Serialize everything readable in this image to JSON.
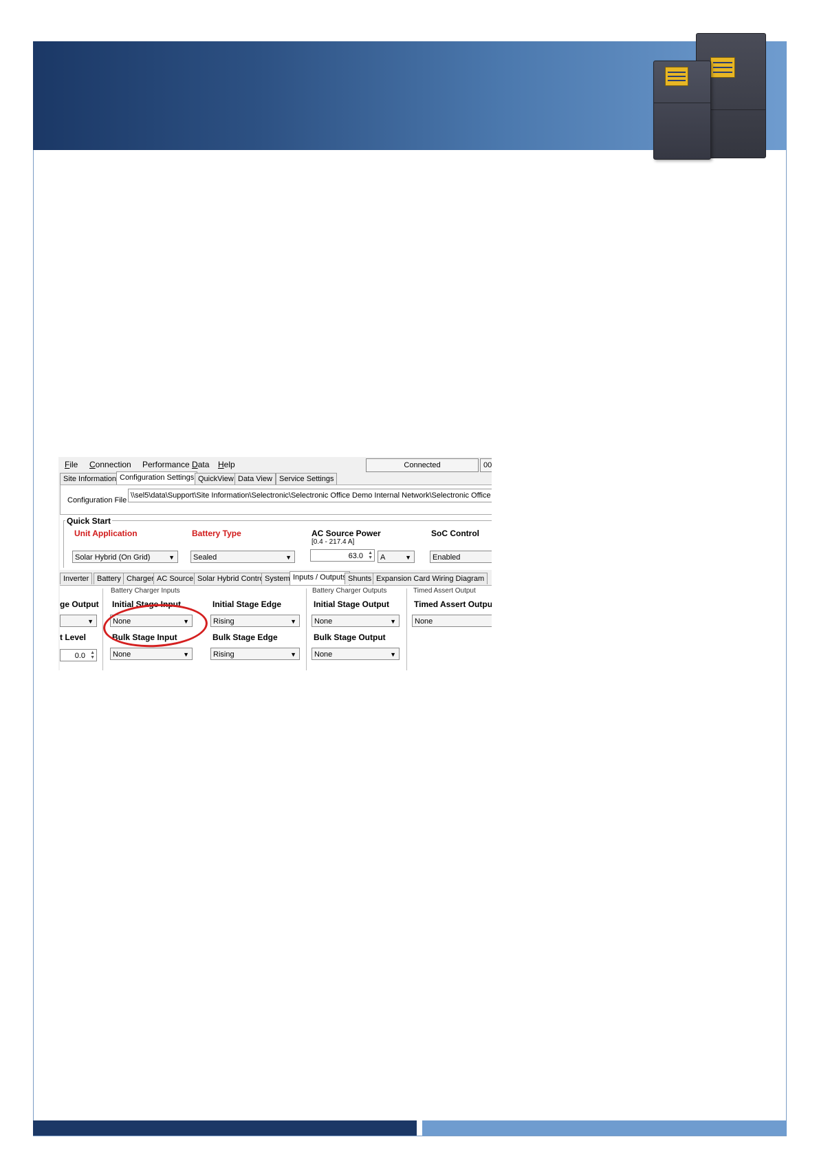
{
  "app": {
    "menu": [
      {
        "label": "File",
        "key": "F"
      },
      {
        "label": "Connection",
        "key": "C"
      },
      {
        "label": "Performance Data",
        "key": "D"
      },
      {
        "label": "Help",
        "key": "H"
      }
    ],
    "status": "Connected",
    "status2": "00",
    "main_tabs": [
      {
        "label": "Site Information",
        "active": false
      },
      {
        "label": "Configuration Settings",
        "active": true
      },
      {
        "label": "QuickView",
        "active": false
      },
      {
        "label": "Data View",
        "active": false
      },
      {
        "label": "Service Settings",
        "active": false
      }
    ],
    "config_file": {
      "label": "Configuration File",
      "value": "\\\\sel5\\data\\Support\\Site Information\\Selectronic\\Selectronic Office Demo Internal Network\\Selectronic Office Demo"
    },
    "quick_start": {
      "title": "Quick Start",
      "unit_application": {
        "label": "Unit Application",
        "value": "Solar Hybrid (On Grid)"
      },
      "battery_type": {
        "label": "Battery Type",
        "value": "Sealed"
      },
      "ac_source_power": {
        "label": "AC Source Power",
        "range": "[0.4 - 217.4 A]",
        "value": "63.0",
        "unit": "A"
      },
      "soc_control": {
        "label": "SoC Control",
        "value": "Enabled"
      }
    },
    "sub_tabs": [
      {
        "label": "Inverter",
        "active": false
      },
      {
        "label": "Battery",
        "active": false
      },
      {
        "label": "Charger",
        "active": false
      },
      {
        "label": "AC Source",
        "active": false
      },
      {
        "label": "Solar Hybrid Control",
        "active": false
      },
      {
        "label": "System",
        "active": false
      },
      {
        "label": "Inputs / Outputs",
        "active": true
      },
      {
        "label": "Shunts",
        "active": false
      },
      {
        "label": "Expansion Card Wiring Diagram",
        "active": false
      }
    ],
    "io": {
      "left_partial": {
        "field1": "ge Output",
        "field2": "t Level",
        "value2": "0.0"
      },
      "charger_inputs": {
        "title": "Battery Charger Inputs",
        "initial_stage_input": {
          "label": "Initial Stage Input",
          "value": "None"
        },
        "initial_stage_edge": {
          "label": "Initial Stage Edge",
          "value": "Rising"
        },
        "bulk_stage_input": {
          "label": "Bulk Stage Input",
          "value": "None"
        },
        "bulk_stage_edge": {
          "label": "Bulk Stage Edge",
          "value": "Rising"
        }
      },
      "charger_outputs": {
        "title": "Battery Charger Outputs",
        "initial_stage_output": {
          "label": "Initial Stage Output",
          "value": "None"
        },
        "bulk_stage_output": {
          "label": "Bulk Stage Output",
          "value": "None"
        }
      },
      "timed_assert": {
        "title": "Timed Assert Output",
        "timed_assert_output": {
          "label": "Timed Assert Output",
          "value": "None"
        }
      }
    }
  },
  "colors": {
    "header_dark": "#1b3866",
    "header_light": "#6f9ccf",
    "highlight": "#d42020",
    "label_red": "#d11a1a"
  }
}
